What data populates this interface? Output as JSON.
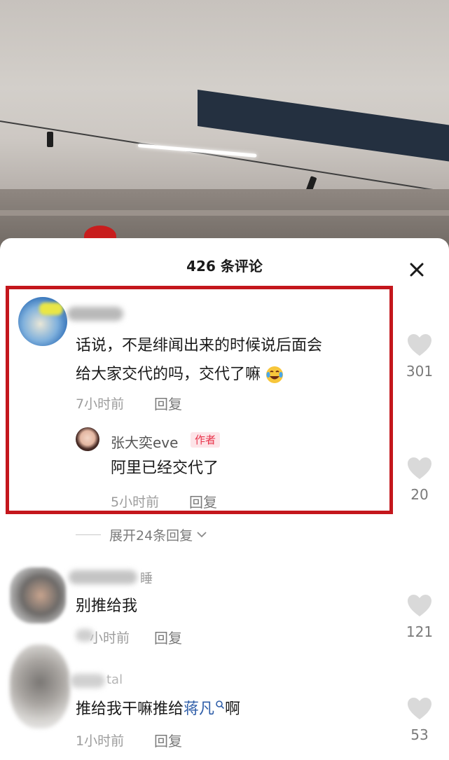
{
  "sheet": {
    "title": "426 条评论"
  },
  "comments": [
    {
      "text_line1": "话说，不是绯闻出来的时候说后面会",
      "text_line2": "给大家交代的吗，交代了嘛",
      "emoji": "rofl-emoji",
      "time": "7小时前",
      "reply_label": "回复",
      "likes": "301",
      "author_reply": {
        "name": "张大奕eve",
        "tag": "作者",
        "text": "阿里已经交代了",
        "time": "5小时前",
        "reply_label": "回复",
        "likes": "20"
      },
      "expand_label": "展开24条回复"
    },
    {
      "name_fragment": "睡",
      "text": "别推给我",
      "time": "小时前",
      "reply_label": "回复",
      "likes": "121"
    },
    {
      "name_fragment": "tal",
      "text_before": "推给我干嘛推给",
      "text_link": "蒋凡",
      "text_after": "啊",
      "time": "1小时前",
      "reply_label": "回复",
      "likes": "53"
    }
  ],
  "colors": {
    "highlight": "#c4161c",
    "author_tag_text": "#e8334a",
    "link": "#2f5ea8"
  },
  "icons": [
    "close-icon",
    "heart-icon",
    "chevron-down-icon",
    "search-icon",
    "rofl-emoji"
  ]
}
